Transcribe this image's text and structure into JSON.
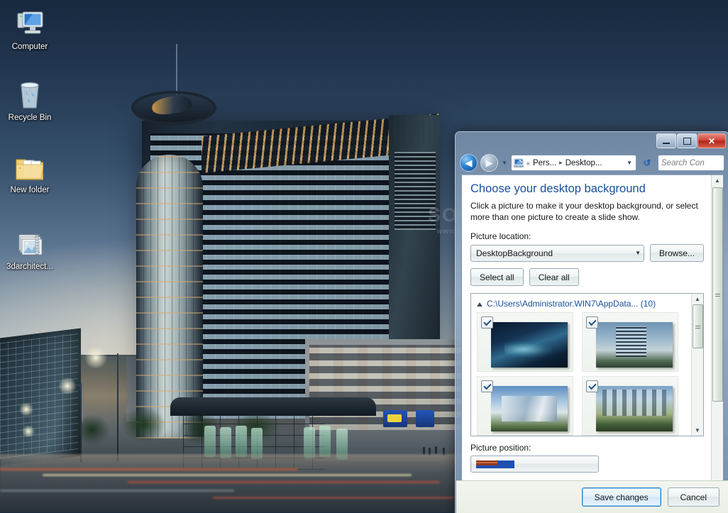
{
  "desktop": {
    "icons": [
      {
        "label": "Computer",
        "icon": "computer-icon"
      },
      {
        "label": "Recycle Bin",
        "icon": "recycle-bin-icon"
      },
      {
        "label": "New folder",
        "icon": "folder-icon"
      },
      {
        "label": "3darchitect...",
        "icon": "zip-archive-icon"
      }
    ],
    "watermark": {
      "line1": "SOFT",
      "line2": "www.so..."
    }
  },
  "window": {
    "title": "",
    "controls": {
      "minimize": "minimize-button",
      "maximize": "maximize-button",
      "close": "✕"
    },
    "nav": {
      "back": "◀",
      "forward": "▶",
      "recent_caret": "▼",
      "refresh": "↺"
    },
    "address": {
      "icon": "personalization-icon",
      "overflow": "«",
      "crumbs": [
        "Pers...",
        "Desktop..."
      ],
      "separator": "▸",
      "caret": "▼"
    },
    "search": {
      "placeholder": "Search Con"
    }
  },
  "page": {
    "title": "Choose your desktop background",
    "subtitle": "Click a picture to make it your desktop background, or select more than one picture to create a slide show.",
    "picture_location_label": "Picture location:",
    "picture_location_value": "DesktopBackground",
    "browse_label": "Browse...",
    "select_all_label": "Select all",
    "clear_all_label": "Clear all",
    "picture_position_label": "Picture position:",
    "group": {
      "expander": "▾",
      "path": "C:\\Users\\Administrator.WIN7\\AppData... (10)"
    },
    "thumbnails": [
      {
        "name": "thumbnail-aerial-night-plaza",
        "checked": true,
        "style": "tp1"
      },
      {
        "name": "thumbnail-highrise-daylight",
        "checked": true,
        "style": "tp2"
      },
      {
        "name": "thumbnail-white-mall-building",
        "checked": true,
        "style": "tp3"
      },
      {
        "name": "thumbnail-residential-towers",
        "checked": true,
        "style": "tp4"
      }
    ],
    "scroll": {
      "up": "▲",
      "down": "▼"
    }
  },
  "footer": {
    "save_label": "Save changes",
    "cancel_label": "Cancel"
  },
  "colors": {
    "heading": "#1a4f9c",
    "link": "#1a4f9c",
    "close_button": "#cf4030",
    "focus_ring": "#2f7fc4"
  }
}
